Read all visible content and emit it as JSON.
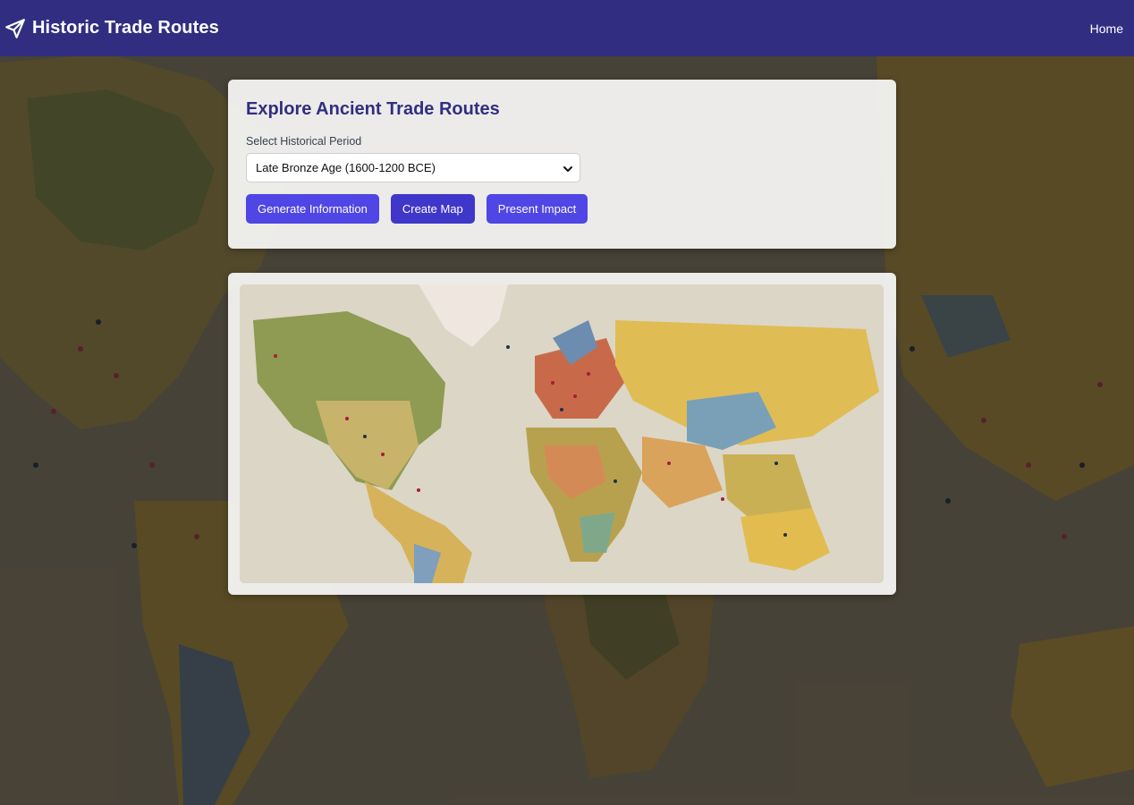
{
  "header": {
    "brand_icon": "paper-plane-icon",
    "title": "Historic Trade Routes",
    "nav_home": "Home"
  },
  "controls": {
    "heading": "Explore Ancient Trade Routes",
    "period_label": "Select Historical Period",
    "period_selected": "Late Bronze Age (1600-1200 BCE)",
    "buttons": {
      "generate": "Generate Information",
      "create_map": "Create Map",
      "present": "Present Impact"
    }
  },
  "colors": {
    "header_bg": "#312e81",
    "heading_text": "#312e81",
    "button_bg": "#4f46e5",
    "button_active_bg": "#3f37c9"
  }
}
